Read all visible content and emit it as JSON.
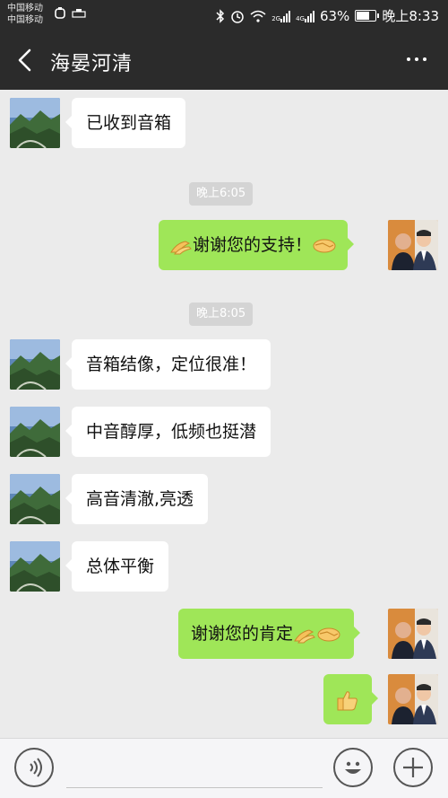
{
  "status_bar": {
    "carrier_1": "中国移动",
    "carrier_2": "中国移动",
    "battery_percent": "63%",
    "battery_level": 0.63,
    "time": "晚上8:33",
    "net_1": "2G",
    "net_2": "4G"
  },
  "header": {
    "title": "海晏河清"
  },
  "messages": [
    {
      "side": "left",
      "text": "已收到音箱"
    },
    {
      "timestamp": "晚上6:05"
    },
    {
      "side": "right",
      "text": "谢谢您的支持！"
    },
    {
      "timestamp": "晚上8:05"
    },
    {
      "side": "left",
      "text": "音箱结像，定位很准！"
    },
    {
      "side": "left",
      "text": "中音醇厚，低频也挺潜"
    },
    {
      "side": "left",
      "text": "高音清澈,亮透"
    },
    {
      "side": "left",
      "text": "总体平衡"
    },
    {
      "side": "right",
      "text": "谢谢您的肯定"
    },
    {
      "side": "right",
      "text": ""
    }
  ],
  "colors": {
    "bar": "#2b2b2b",
    "background": "#ebebeb",
    "sent_bubble": "#9fe658",
    "received_bubble": "#ffffff"
  },
  "icons": {
    "back": "chevron-left-icon",
    "more": "more-dots-icon",
    "voice": "voice-icon",
    "emoji": "smiley-icon",
    "plus": "plus-icon",
    "clap": "clapping-hands-icon",
    "handshake": "handshake-icon",
    "thumbs_up": "thumbs-up-icon"
  }
}
